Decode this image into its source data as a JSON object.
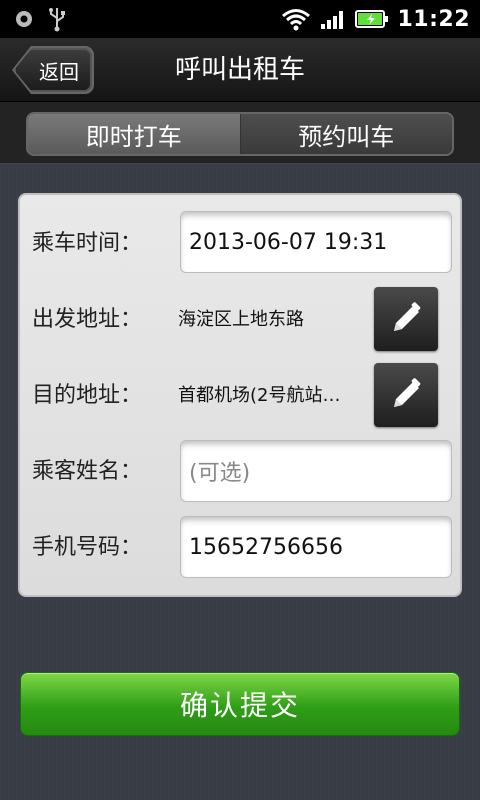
{
  "status_bar": {
    "time": "11:22",
    "icons": [
      "circle-status-icon",
      "usb-icon",
      "wifi-icon",
      "signal-icon",
      "battery-charging-icon"
    ],
    "colors": {
      "battery": "#5ee03a"
    }
  },
  "header": {
    "back_label": "返回",
    "title": "呼叫出租车"
  },
  "tabs": [
    {
      "label": "即时打车",
      "active": true
    },
    {
      "label": "预约叫车",
      "active": false
    }
  ],
  "form": {
    "ride_time": {
      "label": "乘车时间：",
      "value": "2013-06-07 19:31"
    },
    "departure": {
      "label": "出发地址：",
      "value": "海淀区上地东路",
      "edit_icon": "pencil-icon"
    },
    "destination": {
      "label": "目的地址：",
      "value": "首都机场(2号航站…",
      "edit_icon": "pencil-icon"
    },
    "passenger_name": {
      "label": "乘客姓名：",
      "placeholder": "(可选)"
    },
    "phone": {
      "label": "手机号码：",
      "value": "15652756656"
    }
  },
  "submit": {
    "label": "确认提交",
    "color": "#2f9e18"
  }
}
